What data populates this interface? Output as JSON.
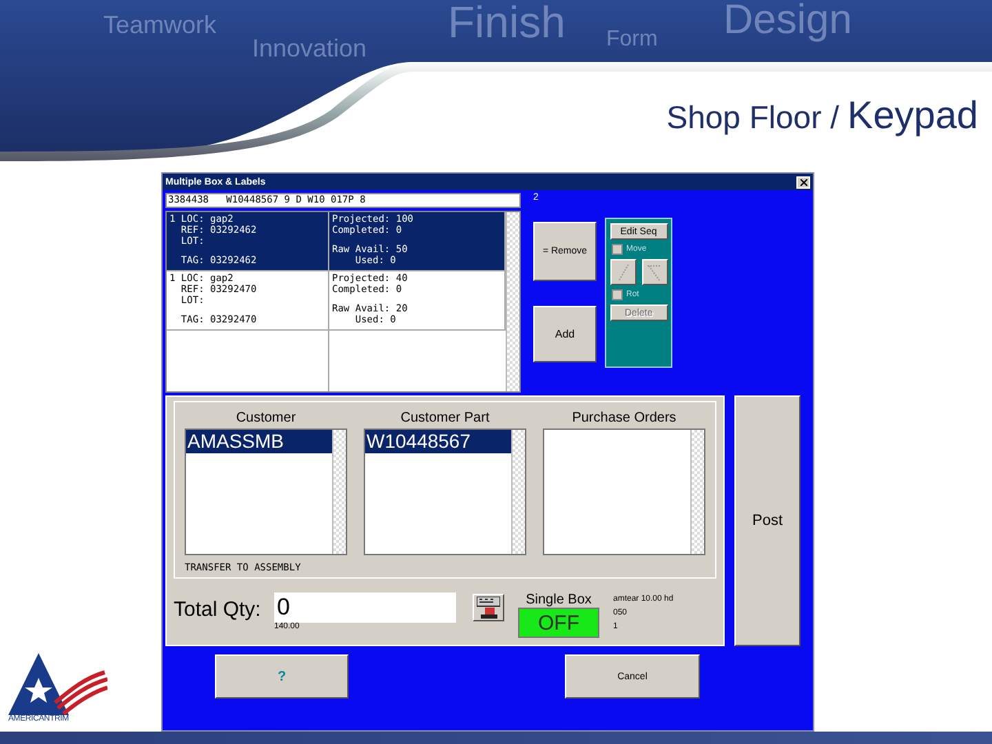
{
  "banner": {
    "words": [
      "Teamwork",
      "Innovation",
      "Finish",
      "Form",
      "Design"
    ],
    "title": "Shop Floor /",
    "title_emphasis": "Keypad"
  },
  "logo": {
    "text": "AMERICANTRIM"
  },
  "window": {
    "title": "Multiple Box & Labels"
  },
  "scan_field": {
    "value": "3384438   W10448567 9 D W10 017P 8"
  },
  "count": "2",
  "sequence": [
    {
      "selected": true,
      "number": "1",
      "left": [
        "LOC: gap2",
        "REF: 03292462",
        "LOT:",
        "TAG: 03292462"
      ],
      "right": [
        "Projected: 100",
        "Completed: 0",
        "Raw Avail: 50",
        "Used: 0"
      ]
    },
    {
      "selected": false,
      "number": "1",
      "left": [
        "LOC: gap2",
        "REF: 03292470",
        "LOT:",
        "TAG: 03292470"
      ],
      "right": [
        "Projected: 40",
        "Completed: 0",
        "Raw Avail: 20",
        "Used: 0"
      ]
    }
  ],
  "remove_button": "= Remove",
  "add_button": "Add",
  "edit_panel": {
    "edit_button": {
      "label": "Edit Seq",
      "disabled": false
    },
    "move": {
      "label": "Move",
      "checked": false
    },
    "rot": {
      "label": "Rot",
      "checked": false
    },
    "delete_button": {
      "label": "Delete",
      "disabled": true
    }
  },
  "lists": [
    {
      "header": "Customer",
      "items": [
        {
          "text": "AMASSMB",
          "selected": true
        }
      ]
    },
    {
      "header": "Customer Part",
      "items": [
        {
          "text": "W10448567",
          "selected": true
        }
      ]
    },
    {
      "header": "Purchase Orders"
    }
  ],
  "transfer_label": "TRANSFER TO ASSEMBLY",
  "total_qty": {
    "label": "Total Qty:",
    "value": "0",
    "sub": "140.00"
  },
  "single_box": {
    "label": "Single Box",
    "state": "OFF",
    "on": false
  },
  "info": [
    "amtear 10.00 hd",
    "050",
    "1"
  ],
  "post_button": "Post",
  "help_button": "?",
  "cancel_button": "Cancel"
}
